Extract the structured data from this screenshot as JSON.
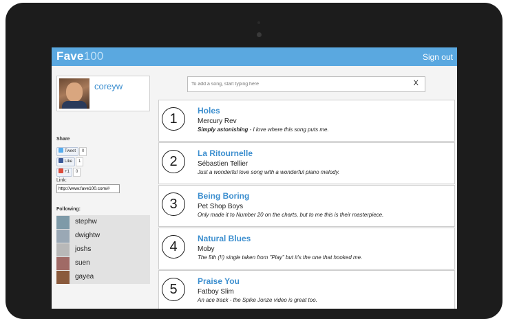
{
  "app": {
    "name_part1": "Fave",
    "name_part2": "100"
  },
  "header": {
    "signout_label": "Sign out"
  },
  "profile": {
    "username": "coreyw"
  },
  "share": {
    "heading": "Share",
    "tweet_label": "Tweet",
    "tweet_count": "0",
    "like_label": "Like",
    "like_count": "1",
    "plus_label": "+1",
    "plus_count": "0",
    "link_label": "Link:",
    "link_value": "http://www.fave100.com/#"
  },
  "following": {
    "heading": "Following:",
    "users": [
      {
        "name": "stephw",
        "color": "#7e9aa8"
      },
      {
        "name": "dwightw",
        "color": "#9aa8b5"
      },
      {
        "name": "joshs",
        "color": "#b8b8b8"
      },
      {
        "name": "suen",
        "color": "#a06a66"
      },
      {
        "name": "gayea",
        "color": "#8a5a3c"
      }
    ]
  },
  "add_song": {
    "placeholder": "To add a song, start typing here",
    "clear_label": "X"
  },
  "songs": [
    {
      "rank": "1",
      "title": "Holes",
      "artist": "Mercury Rev",
      "comment_bold": "Simply astonishing",
      "comment_rest": " - I love where this song puts me."
    },
    {
      "rank": "2",
      "title": "La Ritournelle",
      "artist": "Sébastien Tellier",
      "comment_bold": "",
      "comment_rest": "Just a wonderful love song with a wonderful piano melody."
    },
    {
      "rank": "3",
      "title": "Being Boring",
      "artist": "Pet Shop Boys",
      "comment_bold": "",
      "comment_rest": "Only made it to Number 20 on the charts, but to me this is their masterpiece."
    },
    {
      "rank": "4",
      "title": "Natural Blues",
      "artist": "Moby",
      "comment_bold": "",
      "comment_rest": "The 5th (!!) single taken from \"Play\" but it's the one that hooked me."
    },
    {
      "rank": "5",
      "title": "Praise You",
      "artist": "Fatboy Slim",
      "comment_bold": "",
      "comment_rest": "An ace track - the Spike Jonze video is great too."
    }
  ],
  "colors": {
    "accent": "#5aa8e0",
    "link": "#3d8fcf",
    "bezel": "#1c1c1c"
  }
}
